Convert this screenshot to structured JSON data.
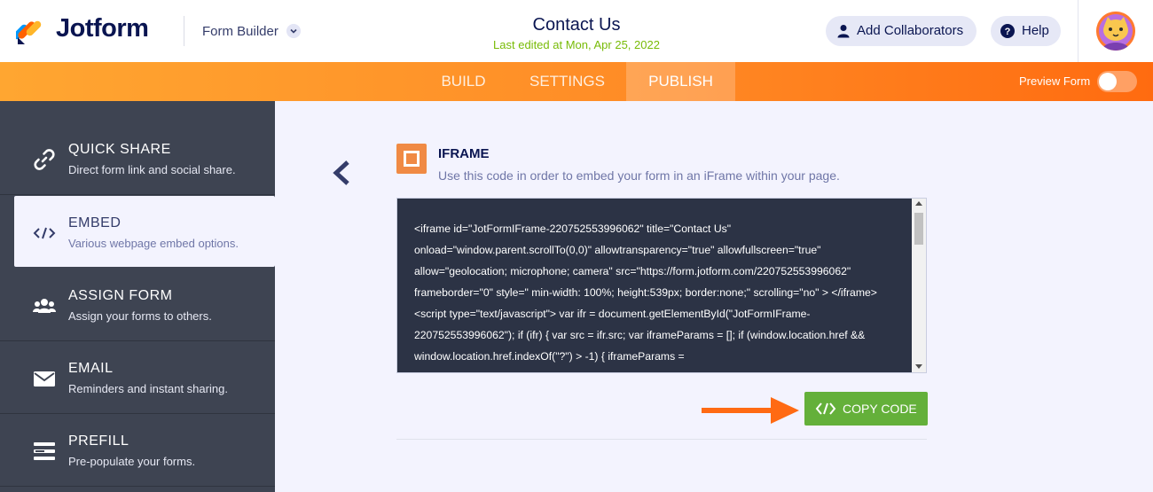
{
  "header": {
    "logo_text": "Jotform",
    "builder_label": "Form Builder",
    "form_title": "Contact Us",
    "last_edited": "Last edited at Mon, Apr 25, 2022",
    "collab_label": "Add Collaborators",
    "help_label": "Help"
  },
  "nav": {
    "tabs": [
      "BUILD",
      "SETTINGS",
      "PUBLISH"
    ],
    "active_tab": "PUBLISH",
    "preview_label": "Preview Form",
    "preview_on": false
  },
  "sidebar": {
    "items": [
      {
        "title": "QUICK SHARE",
        "sub": "Direct form link and social share.",
        "icon": "link-icon"
      },
      {
        "title": "EMBED",
        "sub": "Various webpage embed options.",
        "icon": "code-icon"
      },
      {
        "title": "ASSIGN FORM",
        "sub": "Assign your forms to others.",
        "icon": "users-icon"
      },
      {
        "title": "EMAIL",
        "sub": "Reminders and instant sharing.",
        "icon": "envelope-icon"
      },
      {
        "title": "PREFILL",
        "sub": "Pre-populate your forms.",
        "icon": "list-icon"
      }
    ]
  },
  "embed": {
    "title": "IFRAME",
    "description": "Use this code in order to embed your form in an iFrame within your page.",
    "code": " <iframe id=\"JotFormIFrame-220752553996062\" title=\"Contact Us\"\nonload=\"window.parent.scrollTo(0,0)\" allowtransparency=\"true\" allowfullscreen=\"true\"\nallow=\"geolocation; microphone; camera\" src=\"https://form.jotform.com/220752553996062\"\nframeborder=\"0\" style=\" min-width: 100%; height:539px; border:none;\" scrolling=\"no\" > </iframe>\n<script type=\"text/javascript\"> var ifr = document.getElementById(\"JotFormIFrame-\n220752553996062\"); if (ifr) { var src = ifr.src; var iframeParams = []; if (window.location.href &&\nwindow.location.href.indexOf(\"?\") > -1) { iframeParams =\niframeParams.concat(window.location.href.substr(window.location.href.indexOf(\"?\") + 1).split('&')); } if",
    "copy_label": "COPY CODE"
  },
  "colors": {
    "accent_orange": "#ff8c26",
    "copy_green": "#64b03a",
    "sidebar_bg": "#3e4452",
    "navy": "#0a1551"
  }
}
